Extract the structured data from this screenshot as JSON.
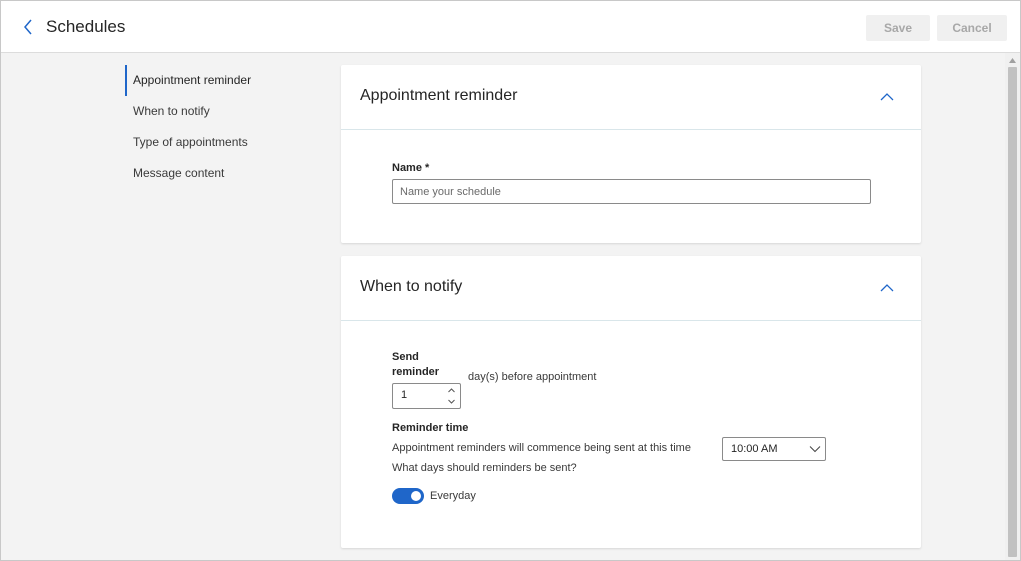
{
  "header": {
    "title": "Schedules",
    "save_label": "Save",
    "cancel_label": "Cancel",
    "back_icon": "chevron-left-icon"
  },
  "nav": {
    "items": [
      {
        "label": "Appointment reminder",
        "active": true
      },
      {
        "label": "When to notify",
        "active": false
      },
      {
        "label": "Type of appointments",
        "active": false
      },
      {
        "label": "Message content",
        "active": false
      }
    ]
  },
  "section_reminder": {
    "title": "Appointment reminder",
    "name_label": "Name *",
    "name_placeholder": "Name your schedule",
    "name_value": ""
  },
  "section_notify": {
    "title": "When to notify",
    "send_label_line1": "Send",
    "send_label_line2": "reminder",
    "days_value": "1",
    "days_suffix": "day(s) before appointment",
    "reminder_time_label": "Reminder time",
    "reminder_time_desc": "Appointment reminders will commence being sent at this time",
    "time_value": "10:00 AM",
    "days_question": "What days should reminders be sent?",
    "everyday_label": "Everyday",
    "everyday_on": true
  },
  "colors": {
    "accent": "#1f66c9",
    "background": "#f3f3f3",
    "card": "#ffffff",
    "disabled_text": "#a8a8a8"
  }
}
